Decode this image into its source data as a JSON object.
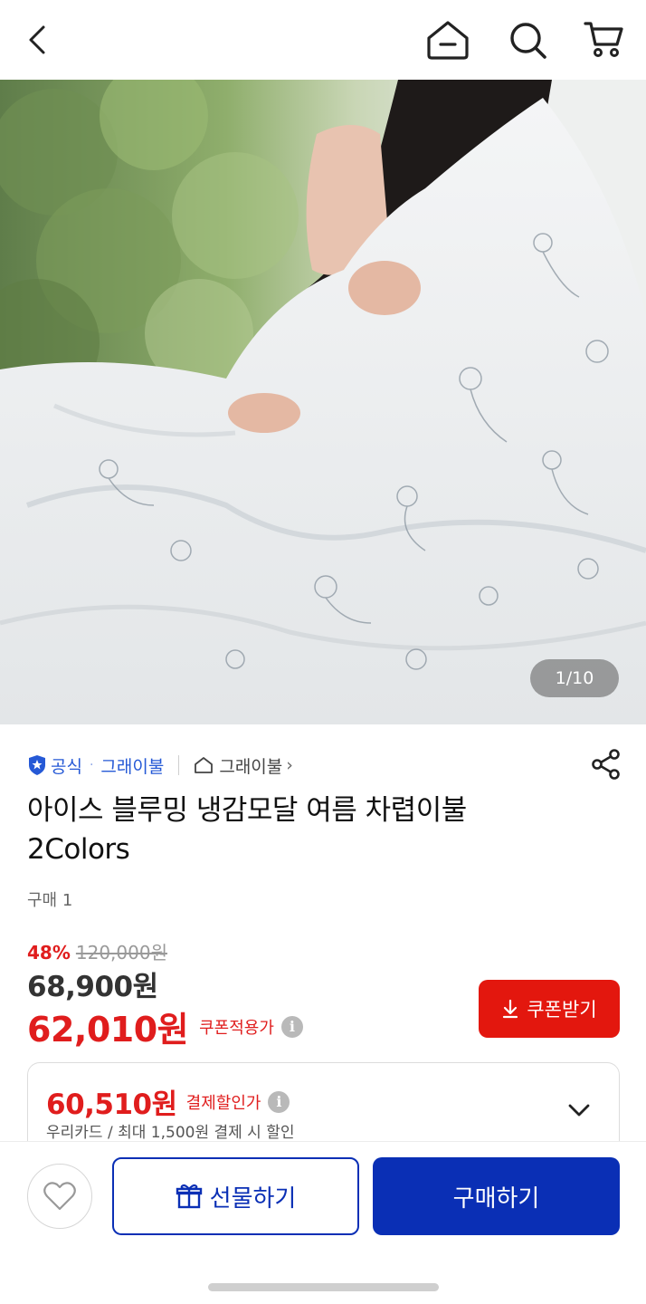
{
  "header": {
    "back_icon": "chevron-left-icon",
    "home_icon": "home-icon",
    "search_icon": "search-icon",
    "cart_icon": "cart-icon"
  },
  "gallery": {
    "counter": "1/10"
  },
  "brand": {
    "official_label": "공식",
    "separator": "·",
    "brand_name": "그래이불",
    "store_name": "그래이불",
    "store_chevron": "›"
  },
  "product": {
    "title_line1": "아이스 블루밍 냉감모달 여름 차렵이불",
    "title_line2": "2Colors",
    "purchase_count": "구매 1",
    "discount_rate": "48%",
    "original_price": "120,000원",
    "sale_price": "68,900원",
    "coupon_price": "62,010원",
    "coupon_price_label": "쿠폰적용가",
    "info_symbol": "i",
    "coupon_button_label": "쿠폰받기"
  },
  "card_offer": {
    "price": "60,510원",
    "label": "결제할인가",
    "description": "우리카드 / 최대 1,500원 결제 시 할인"
  },
  "bottom_bar": {
    "gift_label": "선물하기",
    "buy_label": "구매하기"
  },
  "colors": {
    "accent_red": "#e3170e",
    "brand_blue": "#0a2fb5",
    "official_blue": "#2559d6"
  }
}
